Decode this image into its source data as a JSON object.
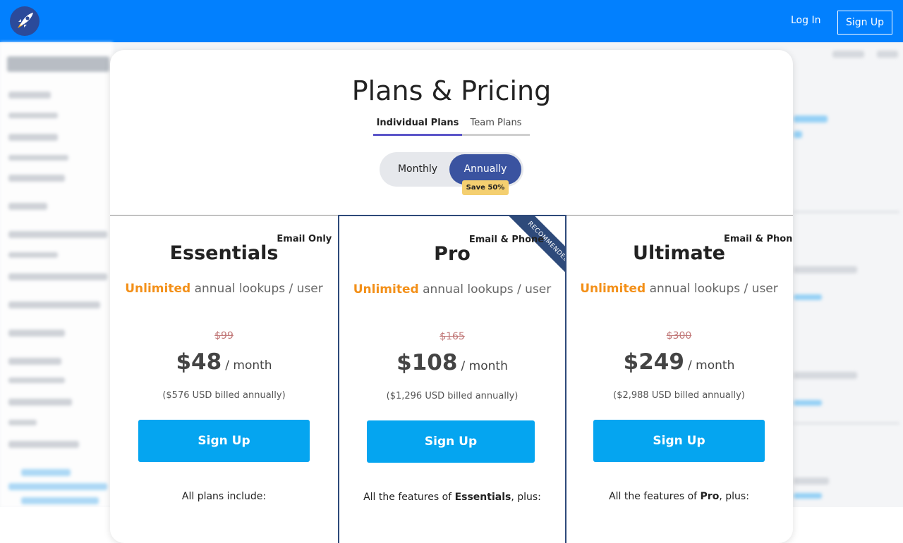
{
  "topbar": {
    "login_label": "Log In",
    "signup_label": "Sign Up",
    "logo_icon": "rocket-icon"
  },
  "modal": {
    "title": "Plans & Pricing",
    "tabs": [
      {
        "label": "Individual Plans",
        "active": true
      },
      {
        "label": "Team Plans",
        "active": false
      }
    ],
    "billing": {
      "monthly_label": "Monthly",
      "annually_label": "Annually",
      "selected": "Annually",
      "save_badge": "Save 50%"
    },
    "plans": [
      {
        "name": "Essentials",
        "tag": "Email Only",
        "unlimited": "Unlimited",
        "lookups": "annual lookups / user",
        "old_price": "$99",
        "price": "$48",
        "period": "/ month",
        "billed": "($576 USD billed annually)",
        "button": "Sign Up",
        "includes_text": "All plans include:"
      },
      {
        "name": "Pro",
        "tag": "Email & Phone",
        "ribbon": "RECOMMENDED",
        "unlimited": "Unlimited",
        "lookups": "annual lookups / user",
        "old_price": "$165",
        "price": "$108",
        "period": "/ month",
        "billed": "($1,296 USD billed annually)",
        "button": "Sign Up",
        "includes_pre": "All the features of ",
        "includes_bold": "Essentials",
        "includes_post": ", plus:"
      },
      {
        "name": "Ultimate",
        "tag": "Email & Phone",
        "unlimited": "Unlimited",
        "lookups": "annual lookups / user",
        "old_price": "$300",
        "price": "$249",
        "period": "/ month",
        "billed": "($2,988 USD billed annually)",
        "button": "Sign Up",
        "includes_pre": "All the features of ",
        "includes_bold": "Pro",
        "includes_post": ", plus:"
      }
    ]
  },
  "colors": {
    "topbar": "#0280fe",
    "accent_orange": "#f39019",
    "button_blue": "#05a5f0",
    "toggle_active": "#3a53a0",
    "badge": "#f4cf70",
    "ribbon": "#2e4a7a",
    "tab_underline": "#5b55c9"
  }
}
